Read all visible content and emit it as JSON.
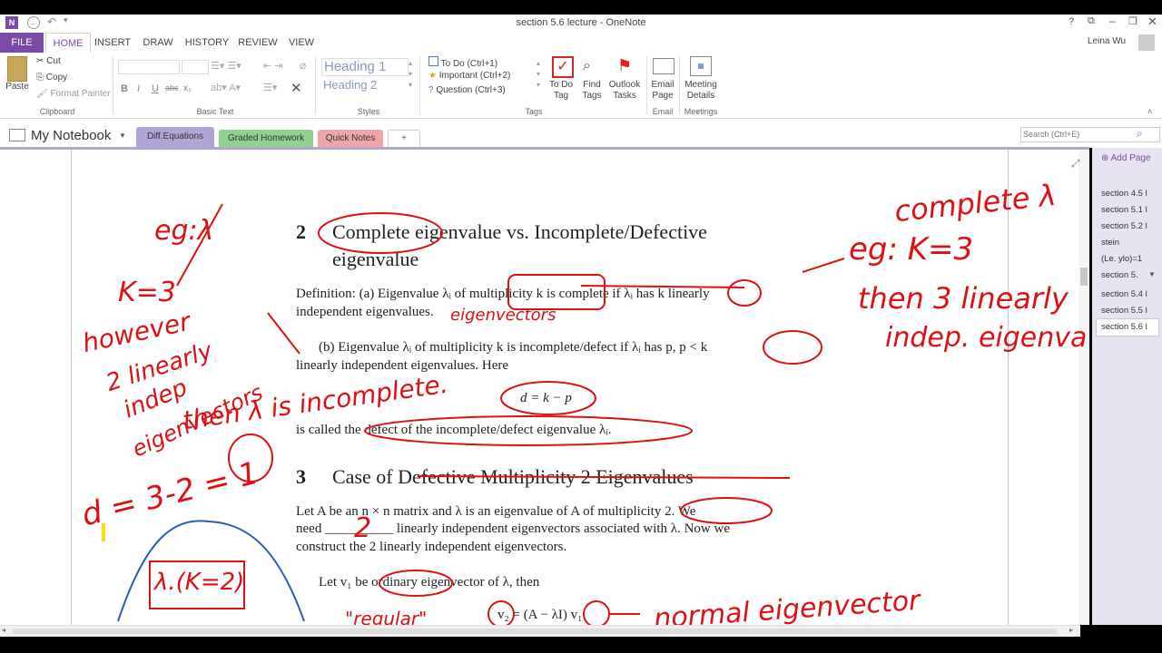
{
  "window": {
    "title": "section 5.6 lecture - OneNote",
    "help": "?",
    "user": "Leina Wu"
  },
  "ribbon_tabs": [
    "FILE",
    "HOME",
    "INSERT",
    "DRAW",
    "HISTORY",
    "REVIEW",
    "VIEW"
  ],
  "clipboard": {
    "paste": "Paste",
    "cut": "Cut",
    "copy": "Copy",
    "format_painter": "Format Painter",
    "label": "Clipboard"
  },
  "basic_text": {
    "label": "Basic Text",
    "bold": "B",
    "italic": "I",
    "underline": "U",
    "strike": "abc",
    "subscript": "x₂"
  },
  "styles": {
    "label": "Styles",
    "heading1": "Heading 1",
    "heading2": "Heading 2"
  },
  "tags": {
    "label": "Tags",
    "items": [
      "To Do (Ctrl+1)",
      "Important (Ctrl+2)",
      "Question (Ctrl+3)"
    ],
    "todo_tag": "To Do\nTag",
    "find_tags": "Find\nTags",
    "outlook_tasks": "Outlook\nTasks"
  },
  "email": {
    "label": "Email",
    "email_page": "Email\nPage"
  },
  "meetings": {
    "label": "Meetings",
    "meeting_details": "Meeting\nDetails"
  },
  "notebook": {
    "name": "My Notebook",
    "sections": [
      "Diff.Equations",
      "Graded Homework",
      "Quick Notes"
    ],
    "add": "+"
  },
  "search": {
    "placeholder": "Search (Ctrl+E)"
  },
  "pages": {
    "add_page": "Add Page",
    "list": [
      "section 4.5 l",
      "section 5.1 l",
      "section 5.2 l",
      "stein",
      "(Le. ylo)=1",
      "section 5.",
      "section 5.4 l",
      "section 5.5 l",
      "section 5.6 l"
    ]
  },
  "content": {
    "h2_num": "2",
    "h2_text": "Complete eigenvalue vs. Incomplete/Defective",
    "h2_cont": "eigenvalue",
    "def_a1": "Definition: (a) Eigenvalue λᵢ of multiplicity k is complete if λᵢ has k linearly",
    "def_a2": "independent eigenvalues.",
    "def_b1": "(b) Eigenvalue λᵢ of multiplicity k is incomplete/defect if λᵢ has p, p < k",
    "def_b2": "linearly independent eigenvalues. Here",
    "formula": "d = k − p",
    "called": "is called the defect of the incomplete/defect eigenvalue λᵢ.",
    "h3_num": "3",
    "h3_text": "Case of Defective Multiplicity 2 Eigenvalues",
    "let1": "Let A be an n × n matrix and λ is an eigenvalue of A of multiplicity 2. We",
    "let2": "need __________ linearly independent eigenvectors associated with λ. Now we",
    "let3": "construct the 2 linearly independent eigenvectors.",
    "let4": "Let v₁ be ordinary eigenvector of λ, then",
    "v2": "v₂ = (A − λI) v₁"
  },
  "ink": {
    "eg": "eg:λ",
    "k3": "K=3",
    "however": "however",
    "two_lin": "2 linearly",
    "indep": "indep",
    "eigvec": "eigenvectors",
    "then_x": "then λ is incomplete.",
    "d": "d = 3-2 = 1",
    "complete": "complete λ",
    "egk": "eg: K=3",
    "then3": "then 3 linearly",
    "indepeig": "indep. eigenva",
    "eigenvectors_fix": "eigenvectors",
    "two": "2",
    "normal": "normal eigenvector",
    "lamk": "λ.(K=2)",
    "regular": "\"regular\""
  },
  "colors": {
    "accent": "#7b4aa8",
    "purple_tab": "#b3a4d6",
    "green_tab": "#8fd18f",
    "pink_tab": "#f0a6a6",
    "ink_red": "#dd1111",
    "ink_blue": "#2a5bb8"
  }
}
